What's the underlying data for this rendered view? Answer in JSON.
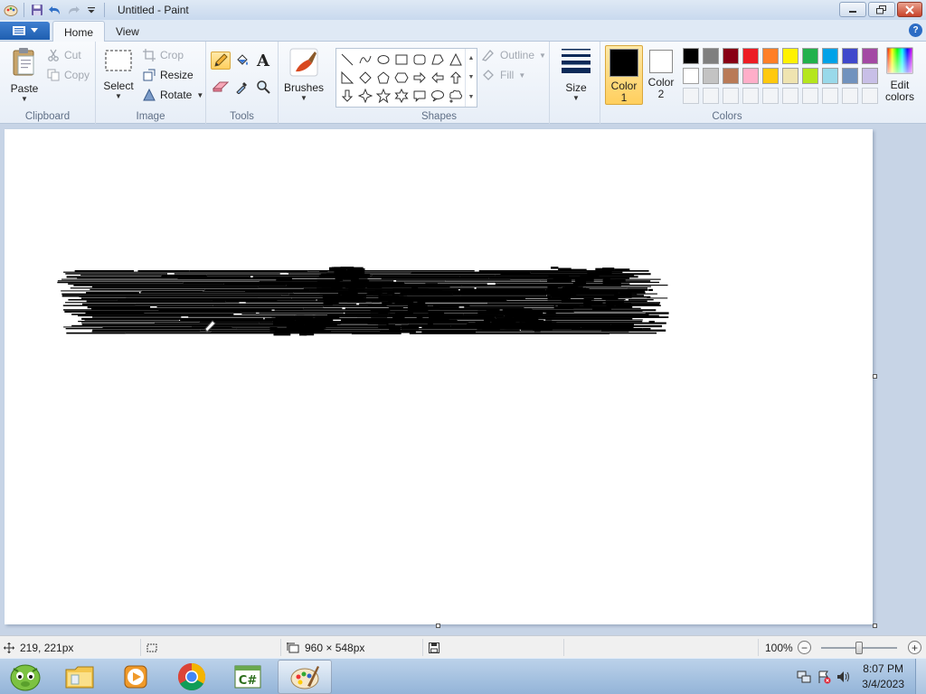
{
  "window": {
    "title": "Untitled - Paint"
  },
  "tabs": [
    {
      "label": "Home",
      "active": true
    },
    {
      "label": "View",
      "active": false
    }
  ],
  "ribbon": {
    "clipboard": {
      "group_label": "Clipboard",
      "paste": "Paste",
      "cut": "Cut",
      "copy": "Copy"
    },
    "image": {
      "group_label": "Image",
      "select": "Select",
      "crop": "Crop",
      "resize": "Resize",
      "rotate": "Rotate"
    },
    "tools": {
      "group_label": "Tools",
      "items": [
        "pencil-icon",
        "fill-icon",
        "text-icon",
        "eraser-icon",
        "color-picker-icon",
        "magnifier-icon"
      ],
      "selected": "pencil-icon"
    },
    "brushes": {
      "label": "Brushes"
    },
    "shapes": {
      "group_label": "Shapes",
      "outline": "Outline",
      "fill": "Fill",
      "items": [
        "line",
        "curve",
        "oval",
        "rectangle",
        "rounded-rectangle",
        "polygon",
        "triangle",
        "right-triangle",
        "diamond",
        "pentagon",
        "hexagon",
        "right-arrow",
        "left-arrow",
        "up-arrow",
        "down-arrow",
        "four-point-star",
        "five-point-star",
        "six-point-star",
        "rounded-callout",
        "oval-callout",
        "cloud-callout"
      ]
    },
    "size": {
      "label": "Size"
    },
    "colors": {
      "group_label": "Colors",
      "color1_label": "Color",
      "color1_num": "1",
      "color2_label": "Color",
      "color2_num": "2",
      "color1_value": "#000000",
      "color2_value": "#ffffff",
      "edit_colors_line1": "Edit",
      "edit_colors_line2": "colors",
      "palette_row1": [
        "#000000",
        "#7f7f7f",
        "#880015",
        "#ed1c24",
        "#ff7f27",
        "#fff200",
        "#22b14c",
        "#00a2e8",
        "#3f48cc",
        "#a349a4"
      ],
      "palette_row2": [
        "#ffffff",
        "#c3c3c3",
        "#b97a57",
        "#ffaec9",
        "#ffc90e",
        "#efe4b0",
        "#b5e61d",
        "#99d9ea",
        "#7092be",
        "#c8bfe7"
      ],
      "palette_row3_empty": 10
    }
  },
  "canvas": {
    "size_text": "960 × 548px"
  },
  "status": {
    "cursor_pos": "219, 221px",
    "canvas_size": "960 × 548px",
    "zoom": "100%"
  },
  "taskbar": {
    "apps": [
      "start-orb-icon",
      "file-explorer-icon",
      "media-player-icon",
      "chrome-icon",
      "csharp-icon",
      "paint-icon"
    ],
    "active_app": "paint-icon",
    "time": "8:07 PM",
    "date": "3/4/2023"
  }
}
